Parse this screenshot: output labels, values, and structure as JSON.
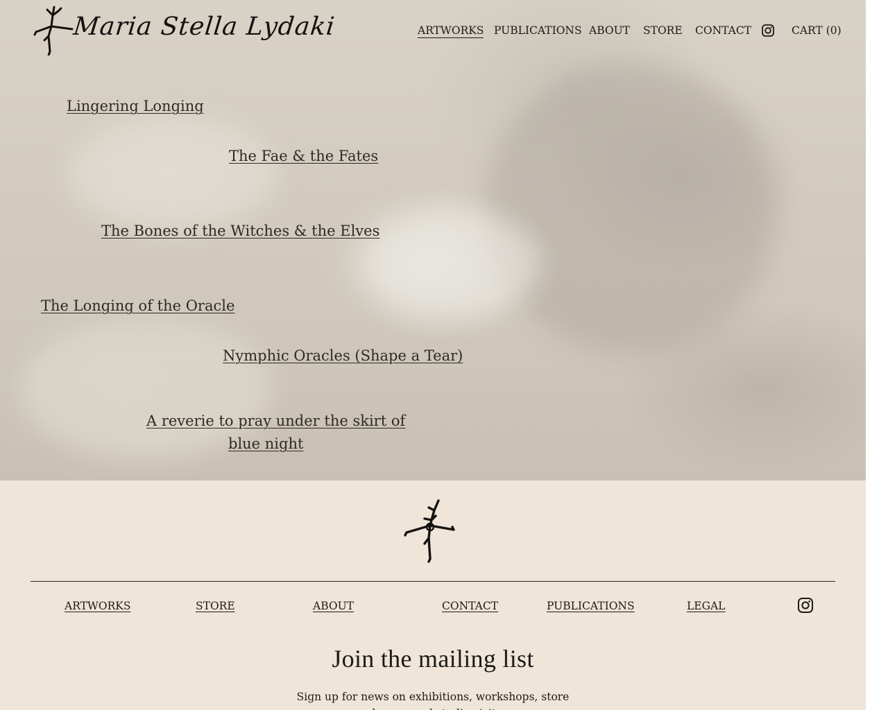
{
  "header": {
    "logo_text": "Maria Stella Lydaki",
    "nav": {
      "artworks": "ARTWORKS",
      "publications": "PUBLICATIONS",
      "about": "ABOUT",
      "store": "STORE",
      "contact": "CONTACT",
      "instagram_icon": "instagram-icon",
      "cart": "CART (0)"
    }
  },
  "hero": {
    "links": [
      "Lingering Longing",
      "The Fae & the Fates",
      "The Bones of the Witches & the Elves",
      "The Longing of the Oracle",
      "Nymphic Oracles (Shape a Tear)",
      "A reverie to pray under the skirt of",
      "blue night"
    ]
  },
  "footer": {
    "nav": {
      "artworks": "ARTWORKS",
      "store": "STORE",
      "about": "ABOUT",
      "contact": "CONTACT",
      "publications": "PUBLICATIONS",
      "legal": "LEGAL"
    },
    "instagram_icon": "instagram-icon",
    "mailing_title": "Join the mailing list",
    "mailing_subtitle": "Sign up for news on exhibitions, workshops, store releases, and studio visits."
  },
  "colors": {
    "footer_bg": "#efe5d8",
    "text": "#1d1b18"
  }
}
